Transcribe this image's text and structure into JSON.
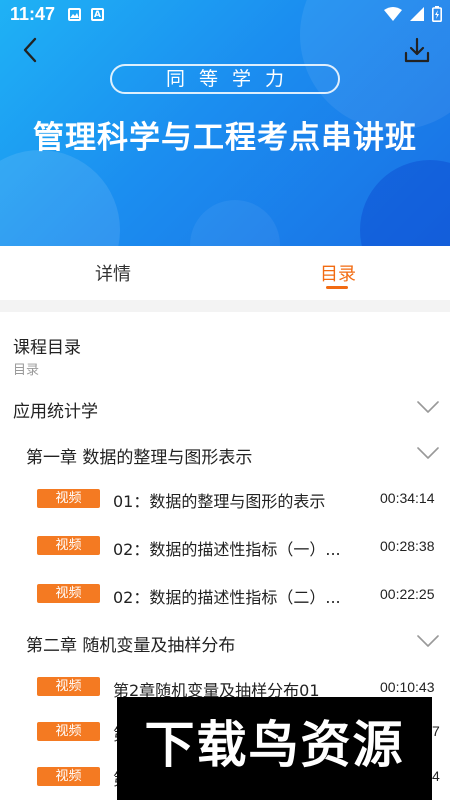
{
  "status_bar": {
    "time": "11:47",
    "a_icon": "A"
  },
  "banner": {
    "pill_text": "同等学力",
    "title": "管理科学与工程考点串讲班"
  },
  "tabs": [
    {
      "label": "详情",
      "active": false
    },
    {
      "label": "目录",
      "active": true
    }
  ],
  "catalog": {
    "title": "课程目录",
    "subtitle": "目录",
    "subject": "应用统计学",
    "chapters": [
      {
        "title": "第一章 数据的整理与图形表示",
        "lessons": [
          {
            "badge": "视频",
            "title": "01：数据的整理与图形的表示",
            "duration": "00:34:14"
          },
          {
            "badge": "视频",
            "title": "02：数据的描述性指标（一）...",
            "duration": "00:28:38"
          },
          {
            "badge": "视频",
            "title": "02：数据的描述性指标（二）...",
            "duration": "00:22:25"
          }
        ]
      },
      {
        "title": "第二章 随机变量及抽样分布",
        "lessons": [
          {
            "badge": "视频",
            "title": "第2章随机变量及抽样分布01",
            "duration": "00:10:43"
          },
          {
            "badge": "视频",
            "title": "第",
            "duration": "7"
          },
          {
            "badge": "视频",
            "title": "第",
            "duration": "4"
          }
        ]
      }
    ]
  },
  "watermark": "下载鸟资源",
  "colors": {
    "accent": "#f26b12",
    "badge": "#f47a22",
    "banner": "#1b8ef0"
  }
}
